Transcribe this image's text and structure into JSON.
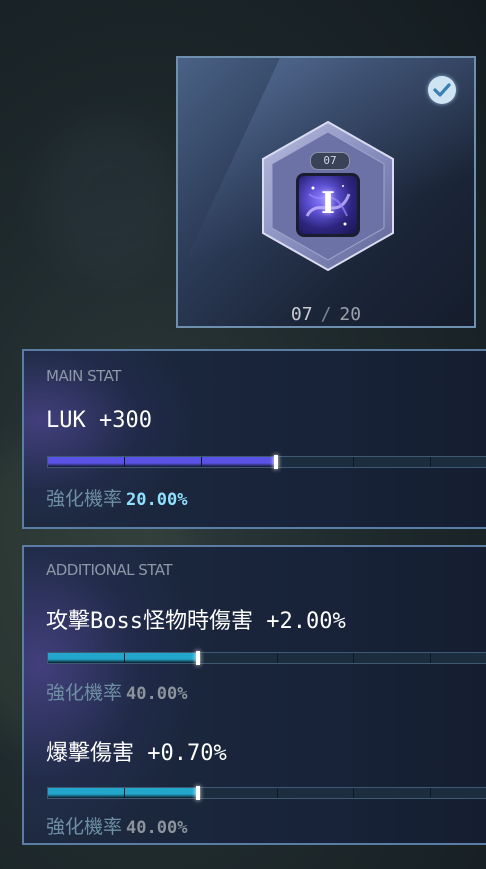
{
  "gem": {
    "level_badge": "07",
    "icon_letter": "I",
    "level_current": "07",
    "level_separator": "/",
    "level_max": "20",
    "selected": true
  },
  "main_stat": {
    "label": "MAIN STAT",
    "stat": "LUK +300",
    "rate_label": "強化機率",
    "rate_value": "20.00%",
    "progress_fraction": 0.5,
    "bar_color": "#5a52e6",
    "rate_color": "#8fe0ff"
  },
  "additional_stat": {
    "label": "ADDITIONAL STAT",
    "lines": [
      {
        "stat": "攻擊Boss怪物時傷害 +2.00%",
        "rate_label": "強化機率",
        "rate_value": "40.00%",
        "progress_fraction": 0.33,
        "bar_color": "#22a6cc"
      },
      {
        "stat": "爆擊傷害 +0.70%",
        "rate_label": "強化機率",
        "rate_value": "40.00%",
        "progress_fraction": 0.33,
        "bar_color": "#22a6cc"
      }
    ]
  },
  "colors": {
    "border": "#5c7da3",
    "rate_value_muted": "#8b949c",
    "check": "#cfe4f2"
  },
  "icons": {
    "check": "check-circle-icon",
    "gem": "galaxy-gem-icon"
  }
}
